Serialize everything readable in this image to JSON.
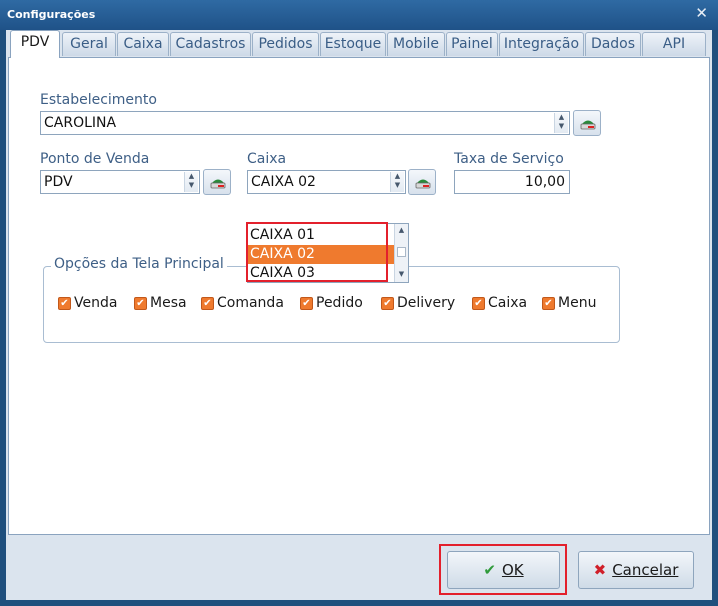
{
  "window": {
    "title": "Configurações"
  },
  "tabs": [
    {
      "label": "PDV"
    },
    {
      "label": "Geral"
    },
    {
      "label": "Caixa"
    },
    {
      "label": "Cadastros"
    },
    {
      "label": "Pedidos"
    },
    {
      "label": "Estoque"
    },
    {
      "label": "Mobile"
    },
    {
      "label": "Painel"
    },
    {
      "label": "Integração"
    },
    {
      "label": "Dados"
    },
    {
      "label": "API"
    }
  ],
  "form": {
    "estabelecimento": {
      "label": "Estabelecimento",
      "value": "CAROLINA"
    },
    "ponto_venda": {
      "label": "Ponto de Venda",
      "value": "PDV"
    },
    "caixa": {
      "label": "Caixa",
      "value": "CAIXA 02",
      "options": [
        "CAIXA 01",
        "CAIXA 02",
        "CAIXA 03"
      ]
    },
    "taxa": {
      "label": "Taxa de Serviço",
      "value": "10,00"
    }
  },
  "group": {
    "title": "Opções da Tela Principal",
    "options": [
      {
        "label": "Venda",
        "checked": true
      },
      {
        "label": "Mesa",
        "checked": true
      },
      {
        "label": "Comanda",
        "checked": true
      },
      {
        "label": "Pedido",
        "checked": true
      },
      {
        "label": "Delivery",
        "checked": true
      },
      {
        "label": "Caixa",
        "checked": true
      },
      {
        "label": "Menu",
        "checked": true
      }
    ]
  },
  "buttons": {
    "ok": {
      "label": "OK",
      "icon": "check-icon"
    },
    "cancel": {
      "label": "Cancelar",
      "icon": "x-icon"
    }
  },
  "colors": {
    "accent": "#ef7a2e",
    "highlight": "#e3202c",
    "title_bar": "#1f5288"
  }
}
